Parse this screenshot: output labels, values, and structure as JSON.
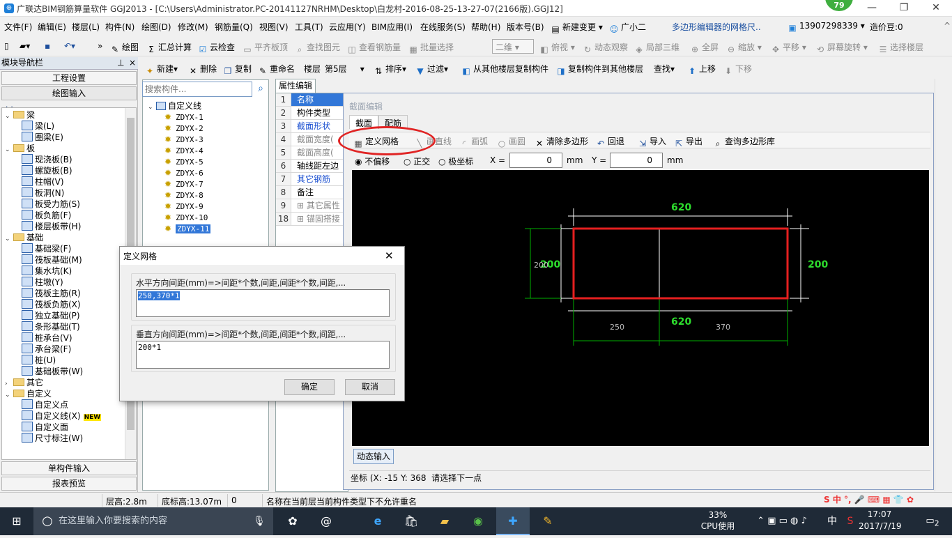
{
  "titlebar": {
    "title": "广联达BIM钢筋算量软件 GGJ2013 - [C:\\Users\\Administrator.PC-20141127NRHM\\Desktop\\白龙村-2016-08-25-13-27-07(2166版).GGJ12]",
    "badge": "79",
    "min": "—",
    "max": "❐",
    "close": "✕"
  },
  "menu": [
    "文件(F)",
    "编辑(E)",
    "楼层(L)",
    "构件(N)",
    "绘图(D)",
    "修改(M)",
    "钢筋量(Q)",
    "视图(V)",
    "工具(T)",
    "云应用(Y)",
    "BIM应用(I)",
    "在线服务(S)",
    "帮助(H)",
    "版本号(B)",
    "新建变更",
    "广小二",
    "多边形编辑器的网格尺..",
    "13907298339",
    "造价豆:0"
  ],
  "toolbar1": {
    "draw": "绘图",
    "calc": "汇总计算",
    "cloudcheck": "云检查",
    "flatboard": "平齐板顶",
    "findelem": "查找图元",
    "viewrebar": "查看钢筋量",
    "batchselect": "批量选择",
    "view2d": "二维",
    "topview": "俯视",
    "dynamic": "动态观察",
    "local3d": "局部三维",
    "fullscreen": "全屏",
    "zoom": "缩放",
    "pan": "平移",
    "rotate": "屏幕旋转",
    "selectfloor": "选择楼层"
  },
  "toolbar2": {
    "new": "新建",
    "delete": "删除",
    "copy": "复制",
    "rename": "重命名",
    "floor_label": "楼层",
    "floor_value": "第5层",
    "sort": "排序",
    "filter": "过滤",
    "copyfrom": "从其他楼层复制构件",
    "copyto": "复制构件到其他楼层",
    "find": "查找",
    "up": "上移",
    "down": "下移"
  },
  "leftpanel": {
    "title": "模块导航栏",
    "pin": "⊥",
    "close": "×",
    "btn_project": "工程设置",
    "btn_draw": "绘图输入",
    "btn_single": "单构件输入",
    "btn_report": "报表预览",
    "tree": [
      {
        "lvl": 0,
        "fold": true,
        "text": "梁",
        "tg": "v"
      },
      {
        "lvl": 1,
        "text": "梁(L)"
      },
      {
        "lvl": 1,
        "text": "圈梁(E)"
      },
      {
        "lvl": 0,
        "fold": true,
        "text": "板",
        "tg": "v"
      },
      {
        "lvl": 1,
        "text": "现浇板(B)"
      },
      {
        "lvl": 1,
        "text": "螺旋板(B)"
      },
      {
        "lvl": 1,
        "text": "柱帽(V)"
      },
      {
        "lvl": 1,
        "text": "板洞(N)"
      },
      {
        "lvl": 1,
        "text": "板受力筋(S)"
      },
      {
        "lvl": 1,
        "text": "板负筋(F)"
      },
      {
        "lvl": 1,
        "text": "楼层板带(H)"
      },
      {
        "lvl": 0,
        "fold": true,
        "text": "基础",
        "tg": "v"
      },
      {
        "lvl": 1,
        "text": "基础梁(F)"
      },
      {
        "lvl": 1,
        "text": "筏板基础(M)"
      },
      {
        "lvl": 1,
        "text": "集水坑(K)"
      },
      {
        "lvl": 1,
        "text": "柱墩(Y)"
      },
      {
        "lvl": 1,
        "text": "筏板主筋(R)"
      },
      {
        "lvl": 1,
        "text": "筏板负筋(X)"
      },
      {
        "lvl": 1,
        "text": "独立基础(P)"
      },
      {
        "lvl": 1,
        "text": "条形基础(T)"
      },
      {
        "lvl": 1,
        "text": "桩承台(V)"
      },
      {
        "lvl": 1,
        "text": "承台梁(F)"
      },
      {
        "lvl": 1,
        "text": "桩(U)"
      },
      {
        "lvl": 1,
        "text": "基础板带(W)"
      },
      {
        "lvl": 0,
        "fold": true,
        "text": "其它",
        "tg": ">"
      },
      {
        "lvl": 0,
        "fold": true,
        "text": "自定义",
        "tg": "v"
      },
      {
        "lvl": 1,
        "text": "自定义点"
      },
      {
        "lvl": 1,
        "text": "自定义线(X)",
        "new": "NEW"
      },
      {
        "lvl": 1,
        "text": "自定义面"
      },
      {
        "lvl": 1,
        "text": "尺寸标注(W)"
      }
    ]
  },
  "list": {
    "search_placeholder": "搜索构件...",
    "root": "自定义线",
    "items": [
      "ZDYX-1",
      "ZDYX-2",
      "ZDYX-3",
      "ZDYX-4",
      "ZDYX-5",
      "ZDYX-6",
      "ZDYX-7",
      "ZDYX-8",
      "ZDYX-9",
      "ZDYX-10",
      "ZDYX-11"
    ]
  },
  "props": {
    "tab": "属性编辑",
    "rows": [
      {
        "n": "1",
        "v": "名称",
        "hl": true
      },
      {
        "n": "2",
        "v": "构件类型"
      },
      {
        "n": "3",
        "v": "截面形状",
        "blue": true
      },
      {
        "n": "4",
        "v": "截面宽度(",
        "gray": true
      },
      {
        "n": "5",
        "v": "截面高度(",
        "gray": true
      },
      {
        "n": "6",
        "v": "轴线距左边"
      },
      {
        "n": "7",
        "v": "其它钢筋",
        "blue": true
      },
      {
        "n": "8",
        "v": "备注"
      },
      {
        "n": "9",
        "v": "⊞ 其它属性",
        "gray": true
      },
      {
        "n": "18",
        "v": "⊞ 锚固搭接",
        "gray": true
      }
    ]
  },
  "editor": {
    "title": "截面编辑",
    "tab_section": "截面",
    "tab_rebar": "配筋",
    "define_grid": "定义网格",
    "line": "画直线",
    "arc": "画弧",
    "circle": "画圆",
    "clear": "清除多边形",
    "undo": "回退",
    "import": "导入",
    "export": "导出",
    "query": "查询多边形库",
    "no_offset": "不偏移",
    "ortho": "正交",
    "polar": "极坐标",
    "x_label": "X =",
    "x_value": "0",
    "y_label": "Y =",
    "y_value": "0",
    "unit": "mm",
    "dim_top": "620",
    "dim_bottom": "620",
    "dim_left": "200",
    "dim_right": "200",
    "dim_left_small": "200",
    "seg1": "250",
    "seg2": "370",
    "dynamic_input": "动态输入",
    "coord_label": "坐标 (X: -15 Y: 368",
    "coord_prompt": "请选择下一点"
  },
  "griddlg": {
    "title": "定义网格",
    "h_label": "水平方向间距(mm)=>间距*个数,间距,间距*个数,间距,...",
    "h_value": "250,370*1",
    "v_label": "垂直方向间距(mm)=>间距*个数,间距,间距*个数,间距,...",
    "v_value": "200*1",
    "ok": "确定",
    "cancel": "取消"
  },
  "status": {
    "floor_h": "层高:2.8m",
    "base_h": "底标高:13.07m",
    "zero": "0",
    "message": "名称在当前层当前构件类型下不允许重名"
  },
  "taskbar": {
    "search": "在这里输入你要搜索的内容",
    "cpu_pct": "33%",
    "cpu_label": "CPU使用",
    "time": "17:07",
    "date": "2017/7/19",
    "ime": "中",
    "notif": "2"
  },
  "colors": {
    "accent": "#1e7fd8",
    "canvas": "#000000",
    "dim_green": "#00c000",
    "red": "#e02424"
  }
}
